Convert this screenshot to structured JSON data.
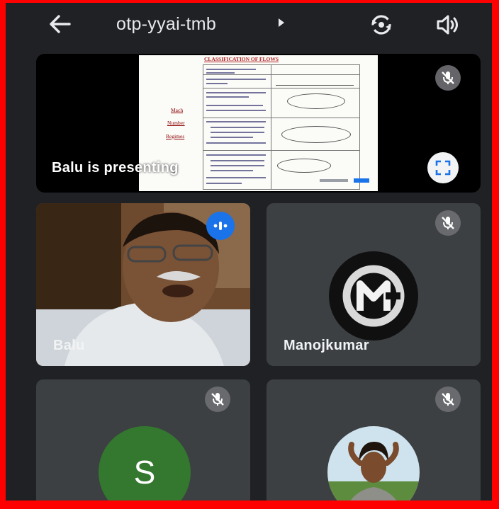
{
  "top_bar": {
    "meeting_code": "otp-yyai-tmb",
    "back_icon": "arrow-left-icon",
    "menu_icon": "caret-right-icon",
    "switch_camera_icon": "switch-camera-icon",
    "speaker_icon": "speaker-icon"
  },
  "presentation": {
    "label": "Balu is presenting",
    "slide": {
      "title": "CLASSIFICATION OF FLOWS",
      "side_labels": [
        "Mach",
        "Number",
        "Regimes"
      ]
    },
    "muted_icon": "mic-off-icon",
    "fullscreen_icon": "fullscreen-icon"
  },
  "participants": [
    {
      "name": "Balu",
      "state": "speaking",
      "badge_icon": "audio-level-icon",
      "has_video": true
    },
    {
      "name": "Manojkumar",
      "state": "muted",
      "badge_icon": "mic-off-icon",
      "avatar": "logo"
    },
    {
      "name": "",
      "state": "muted",
      "badge_icon": "mic-off-icon",
      "avatar_letter": "S",
      "avatar_color": "#34772e"
    },
    {
      "name": "",
      "state": "muted",
      "badge_icon": "mic-off-icon",
      "avatar": "photo"
    }
  ],
  "colors": {
    "screen_border": "#ff0000",
    "background": "#202124",
    "tile": "#3c4043",
    "speaking_accent": "#1a73e8"
  }
}
